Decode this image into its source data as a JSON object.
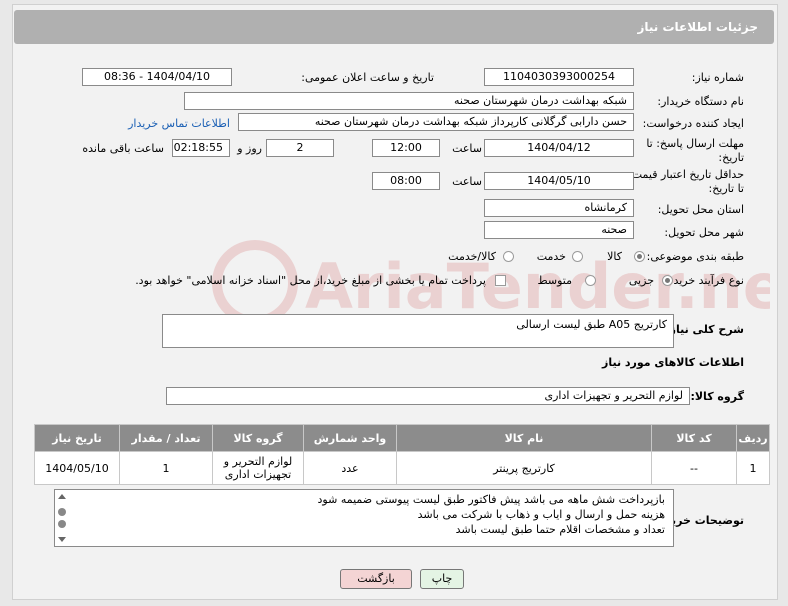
{
  "header": {
    "title": "جزئیات اطلاعات نیاز"
  },
  "form": {
    "need_number_label": "شماره نیاز:",
    "need_number": "1104030393000254",
    "announce_label": "تاریخ و ساعت اعلان عمومی:",
    "announce_value": "1404/04/10 - 08:36",
    "buyer_org_label": "نام دستگاه خریدار:",
    "buyer_org": "شبکه بهداشت درمان شهرستان صحنه",
    "creator_label": "ایجاد کننده درخواست:",
    "creator": "حسن دارابی گرگلانی کارپرداز شبکه بهداشت درمان شهرستان صحنه",
    "contact_link": "اطلاعات تماس خریدار",
    "deadline_label": "مهلت ارسال پاسخ: تا تاریخ:",
    "deadline_date": "1404/04/12",
    "time_label": "ساعت",
    "deadline_time": "12:00",
    "days_value": "2",
    "days_label": "روز و",
    "remaining_time": "02:18:55",
    "remaining_label": "ساعت باقی مانده",
    "validity_label": "حداقل تاریخ اعتبار قیمت: تا تاریخ:",
    "validity_date": "1404/05/10",
    "validity_time": "08:00",
    "province_label": "استان محل تحویل:",
    "province": "کرمانشاه",
    "city_label": "شهر محل تحویل:",
    "city": "صحنه",
    "category_label": "طبقه بندی موضوعی:",
    "category_options": [
      "کالا",
      "خدمت",
      "کالا/خدمت"
    ],
    "purchase_type_label": "نوع فرآیند خرید :",
    "purchase_options": [
      "جزیی",
      "متوسط"
    ],
    "payment_note": "پرداخت تمام یا بخشی از مبلغ خرید،از محل \"اسناد خزانه اسلامی\" خواهد بود.",
    "summary_label": "شرح کلی نیاز:",
    "summary": "کارتریج A05 طبق لیست ارسالی",
    "goods_info_title": "اطلاعات کالاهای مورد نیاز",
    "goods_group_label": "گروه کالا:",
    "goods_group": "لوازم التحریر و تجهیزات اداری"
  },
  "table": {
    "headers": [
      "ردیف",
      "کد کالا",
      "نام کالا",
      "واحد شمارش",
      "گروه کالا",
      "تعداد / مقدار",
      "تاریخ نیاز"
    ],
    "rows": [
      [
        "1",
        "--",
        "کارتریج پرینتر",
        "عدد",
        "لوازم التحریر و تجهیزات اداری",
        "1",
        "1404/05/10"
      ]
    ]
  },
  "notes": {
    "label": "توضیحات خریدار:",
    "lines": [
      "بازپرداخت شش ماهه می باشد پیش فاکتور طبق لیست پیوستی ضمیمه شود",
      "هزینه حمل و ارسال و ایاب و ذهاب با شرکت می باشد",
      "تعداد و مشخصات اقلام حتما طبق لیست باشد"
    ]
  },
  "buttons": {
    "print": "چاپ",
    "back": "بازگشت"
  },
  "watermark": "AriaTender.neT",
  "colors": {
    "header_bg": "#b0b0b0",
    "table_header_bg": "#8c8c8c",
    "link": "#1a5fb4",
    "back_button_bg": "#f4d4d4",
    "print_button_bg": "#e4f4e4"
  }
}
